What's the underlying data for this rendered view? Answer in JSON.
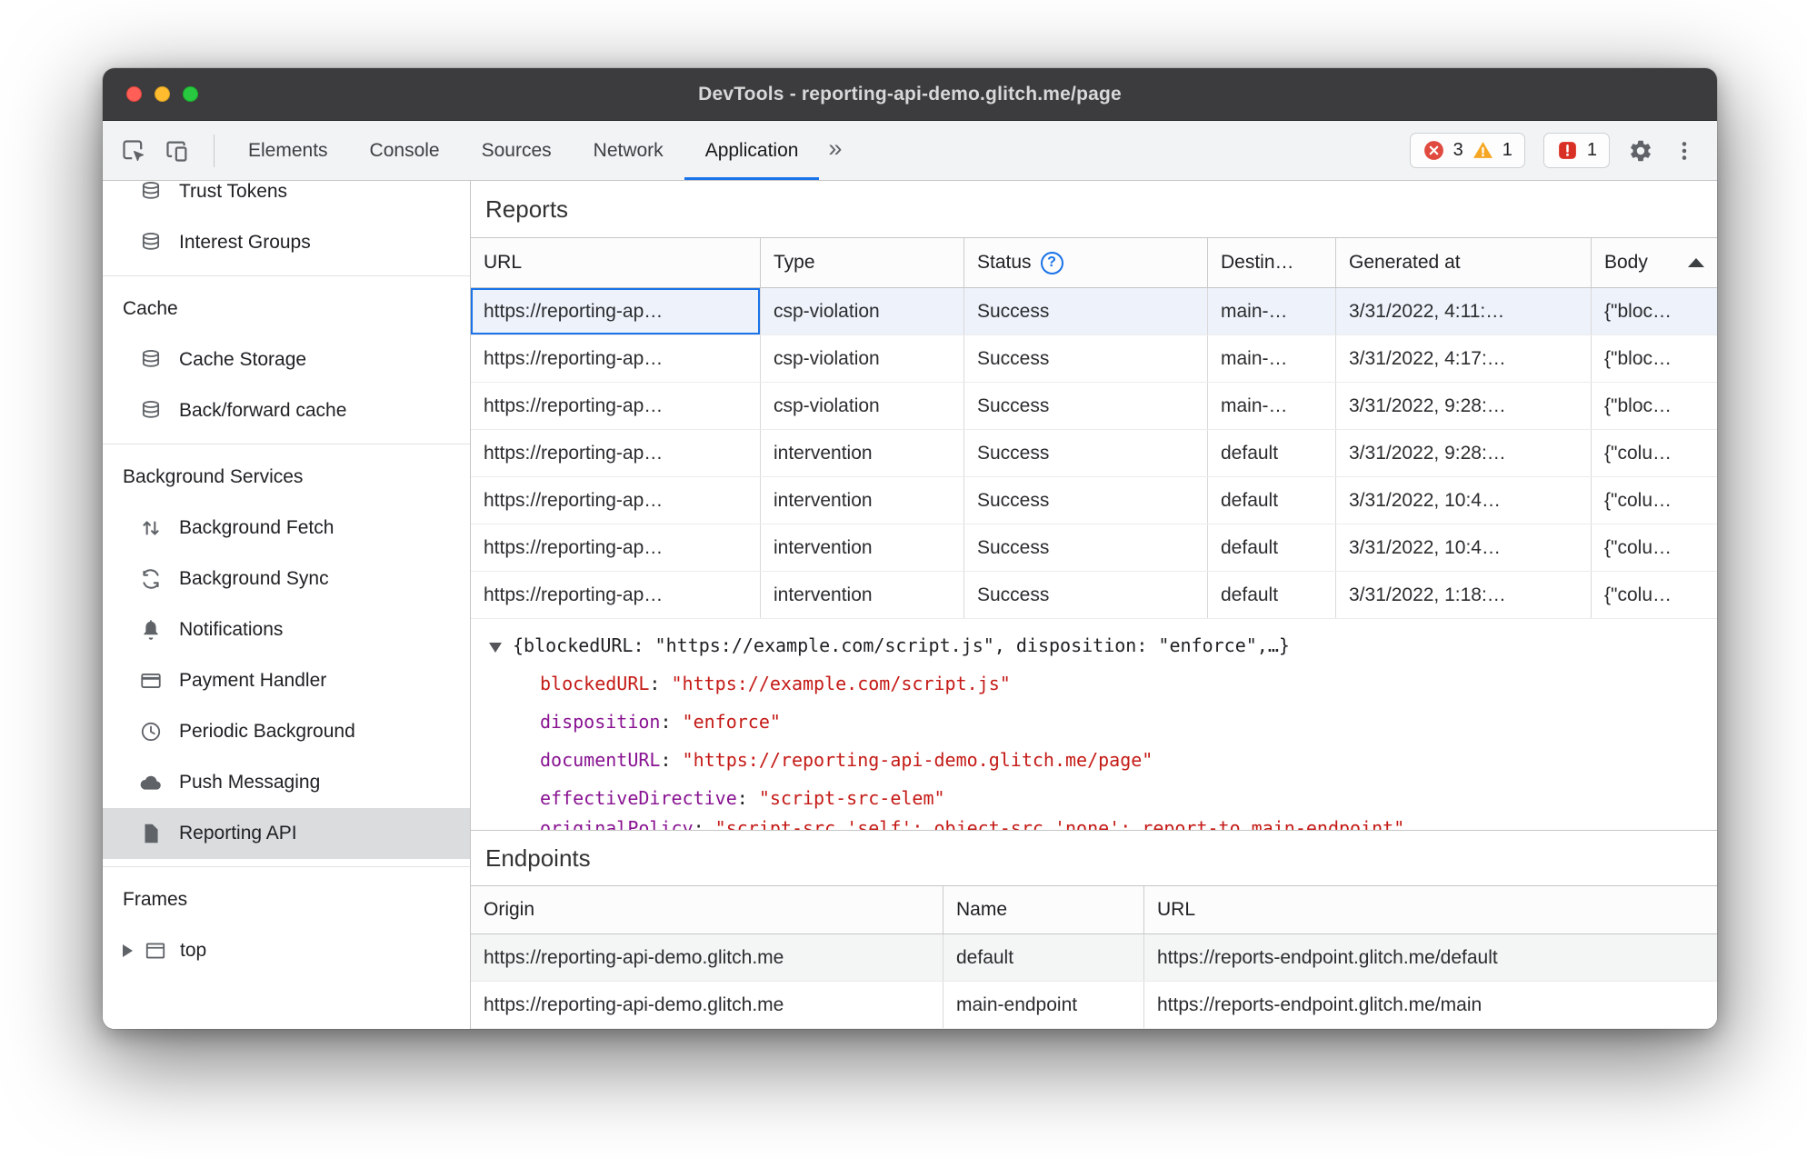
{
  "window": {
    "title": "DevTools - reporting-api-demo.glitch.me/page"
  },
  "toolbar": {
    "tabs": [
      "Elements",
      "Console",
      "Sources",
      "Network",
      "Application"
    ],
    "active_tab": "Application",
    "overflow_indicator": "»",
    "error_count": "3",
    "warning_count": "1",
    "issue_count": "1"
  },
  "sidebar": {
    "top_items": [
      {
        "label": "Trust Tokens",
        "icon": "database-icon"
      },
      {
        "label": "Interest Groups",
        "icon": "database-icon"
      }
    ],
    "sections": [
      {
        "title": "Cache",
        "items": [
          {
            "label": "Cache Storage",
            "icon": "database-icon"
          },
          {
            "label": "Back/forward cache",
            "icon": "database-icon"
          }
        ]
      },
      {
        "title": "Background Services",
        "items": [
          {
            "label": "Background Fetch",
            "icon": "fetch-arrows-icon"
          },
          {
            "label": "Background Sync",
            "icon": "sync-icon"
          },
          {
            "label": "Notifications",
            "icon": "bell-icon"
          },
          {
            "label": "Payment Handler",
            "icon": "card-icon"
          },
          {
            "label": "Periodic Background",
            "icon": "clock-icon"
          },
          {
            "label": "Push Messaging",
            "icon": "cloud-icon"
          },
          {
            "label": "Reporting API",
            "icon": "document-icon",
            "selected": true
          }
        ]
      },
      {
        "title": "Frames",
        "items": [
          {
            "label": "top",
            "icon": "frame-icon"
          }
        ]
      }
    ]
  },
  "reports": {
    "heading": "Reports",
    "columns": [
      "URL",
      "Type",
      "Status",
      "Destin…",
      "Generated at",
      "Body"
    ],
    "rows": [
      {
        "url": "https://reporting-ap…",
        "type": "csp-violation",
        "status": "Success",
        "destination": "main-…",
        "generated": "3/31/2022, 4:11:…",
        "body": "{\"bloc…"
      },
      {
        "url": "https://reporting-ap…",
        "type": "csp-violation",
        "status": "Success",
        "destination": "main-…",
        "generated": "3/31/2022, 4:17:…",
        "body": "{\"bloc…"
      },
      {
        "url": "https://reporting-ap…",
        "type": "csp-violation",
        "status": "Success",
        "destination": "main-…",
        "generated": "3/31/2022, 9:28:…",
        "body": "{\"bloc…"
      },
      {
        "url": "https://reporting-ap…",
        "type": "intervention",
        "status": "Success",
        "destination": "default",
        "generated": "3/31/2022, 9:28:…",
        "body": "{\"colu…"
      },
      {
        "url": "https://reporting-ap…",
        "type": "intervention",
        "status": "Success",
        "destination": "default",
        "generated": "3/31/2022, 10:4…",
        "body": "{\"colu…"
      },
      {
        "url": "https://reporting-ap…",
        "type": "intervention",
        "status": "Success",
        "destination": "default",
        "generated": "3/31/2022, 10:4…",
        "body": "{\"colu…"
      },
      {
        "url": "https://reporting-ap…",
        "type": "intervention",
        "status": "Success",
        "destination": "default",
        "generated": "3/31/2022, 1:18:…",
        "body": "{\"colu…"
      }
    ]
  },
  "preview": {
    "summary": "{blockedURL: \"https://example.com/script.js\", disposition: \"enforce\",…}",
    "properties": [
      {
        "key": "blockedURL",
        "value": "\"https://example.com/script.js\""
      },
      {
        "key": "disposition",
        "value": "\"enforce\""
      },
      {
        "key": "documentURL",
        "value": "\"https://reporting-api-demo.glitch.me/page\""
      },
      {
        "key": "effectiveDirective",
        "value": "\"script-src-elem\""
      }
    ],
    "clipped_key": "originalPolicy",
    "clipped_value": "\"script-src 'self'; object-src 'none'; report-to main-endpoint\""
  },
  "endpoints": {
    "heading": "Endpoints",
    "columns": [
      "Origin",
      "Name",
      "URL"
    ],
    "rows": [
      {
        "origin": "https://reporting-api-demo.glitch.me",
        "name": "default",
        "url": "https://reports-endpoint.glitch.me/default"
      },
      {
        "origin": "https://reporting-api-demo.glitch.me",
        "name": "main-endpoint",
        "url": "https://reports-endpoint.glitch.me/main"
      }
    ]
  },
  "colors": {
    "accent_blue": "#1a73e8",
    "error_red": "#e04a3f",
    "warning_orange": "#f5a623",
    "issue_red": "#d93025",
    "json_key_purple": "#881391",
    "json_string_red": "#c41a16",
    "selected_sidebar_gray": "#dadcde",
    "selected_row_blue": "#edf2fb",
    "titlebar_gray": "#3c3c3e"
  }
}
